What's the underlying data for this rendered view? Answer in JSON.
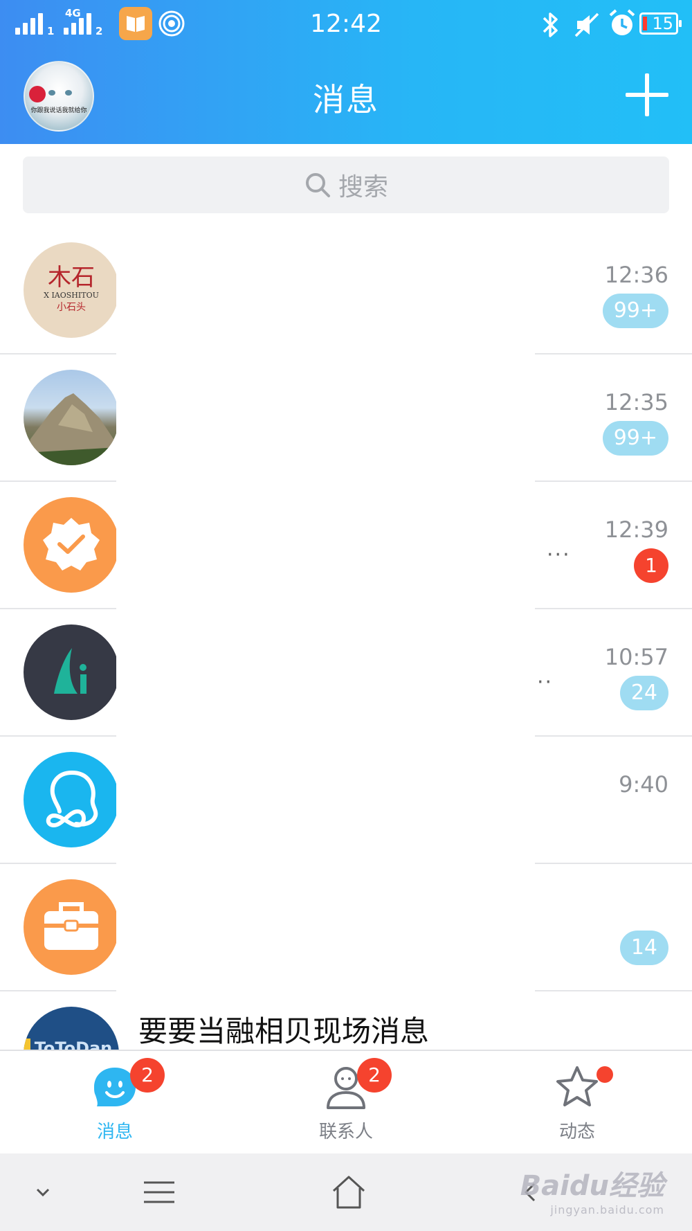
{
  "status_bar": {
    "time": "12:42",
    "network_tag": "4G",
    "sim1": "1",
    "sim2": "2",
    "battery": "15",
    "icons": [
      "signal-icon",
      "app-notification-icon",
      "hotspot-icon",
      "bluetooth-icon",
      "mute-icon",
      "alarm-icon",
      "battery-icon"
    ]
  },
  "header": {
    "title": "消息",
    "profile_avatar_caption": "你跟我说话我就给你",
    "add_icon": "plus-icon"
  },
  "search": {
    "placeholder": "搜索"
  },
  "conversations": [
    {
      "time": "12:36",
      "badge": "99+",
      "avatar_text_1": "X IAOSHITOU",
      "avatar_text_2": "小石头"
    },
    {
      "time": "12:35",
      "badge": "99+"
    },
    {
      "time": "12:39",
      "badge": "1",
      "snippet_tail": "···"
    },
    {
      "time": "10:57",
      "badge": "24",
      "snippet_tail": "··",
      "avatar_letter": "Li"
    },
    {
      "time": "9:40",
      "badge": ""
    },
    {
      "time": "",
      "badge": "14"
    },
    {
      "partial_text": "要要当融相贝现场消息",
      "avatar_text": "ToToDan"
    }
  ],
  "tabs": [
    {
      "label": "消息",
      "badge": "2",
      "active": true
    },
    {
      "label": "联系人",
      "badge": "2",
      "active": false
    },
    {
      "label": "动态",
      "badge": "",
      "active": false
    }
  ],
  "colors": {
    "header_start": "#3d8df2",
    "header_end": "#22bff7",
    "accent": "#2eb6f1",
    "badge_red": "#f5432e",
    "badge_blue": "#9fdcf2"
  },
  "watermark": {
    "brand": "Baidu经验",
    "url": "jingyan.baidu.com"
  }
}
